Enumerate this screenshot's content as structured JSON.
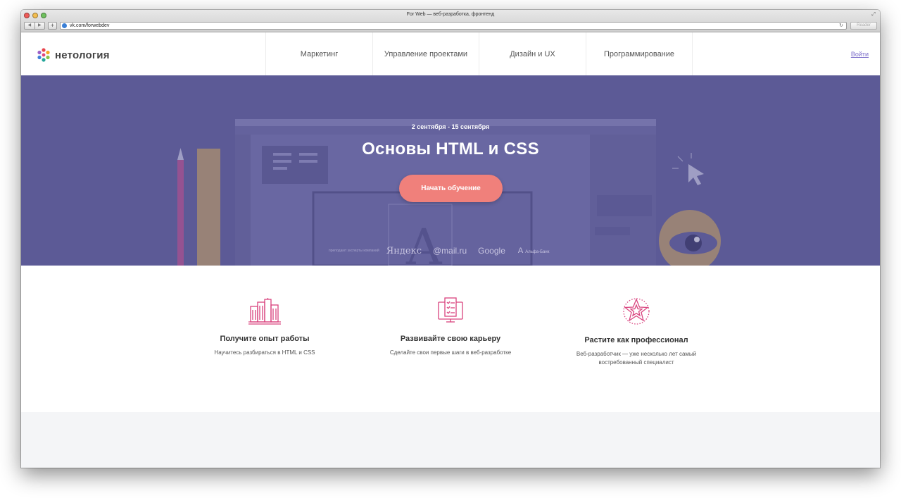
{
  "browser": {
    "title": "For Web — веб-разработка, фронтенд",
    "url": "vk.com/forwebdev",
    "reader_label": "Reader"
  },
  "header": {
    "logo_text": "нетология",
    "menu": [
      {
        "label": "Маркетинг"
      },
      {
        "label": "Управление проектами"
      },
      {
        "label": "Дизайн и UX"
      },
      {
        "label": "Программирование"
      }
    ],
    "login_label": "Войти"
  },
  "hero": {
    "date_range": "2 сентября - 15 сентября",
    "title": "Основы HTML и CSS",
    "cta_label": "Начать обучение",
    "partners_lead": "преподают эксперты компаний",
    "partners": [
      "Яндекс",
      "@mail.ru",
      "Google",
      "Альфа-Банк"
    ],
    "background_color": "#5c5a96",
    "cta_color": "#f0807b"
  },
  "features": [
    {
      "icon": "buildings-icon",
      "title": "Получите опыт работы",
      "description": "Научитесь разбираться в HTML и CSS"
    },
    {
      "icon": "monitor-checklist-icon",
      "title": "Развивайте свою карьеру",
      "description": "Сделайте свои первые шаги в веб-разработке"
    },
    {
      "icon": "star-badge-icon",
      "title": "Растите как профессионал",
      "description": "Веб-разработчик — уже несколько лет самый востребованный специалист"
    }
  ],
  "colors": {
    "accent_pink": "#d9437e",
    "link": "#7a6bc9"
  }
}
